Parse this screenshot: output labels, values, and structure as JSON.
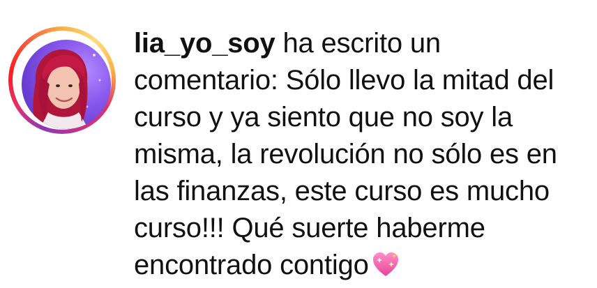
{
  "notification": {
    "username": "lia_yo_soy",
    "action_text": " ha escrito un comentario: ",
    "comment": "Sólo llevo la mitad del curso y ya siento que no soy la misma, la revolución no sólo es en las finanzas, este curso es mucho curso!!! Qué suerte haberme encontrado contigo",
    "emoji_icon": "sparkling-heart-icon",
    "story_ring_colors": [
      "#8a3ab9",
      "#e1306c",
      "#fd1d1d",
      "#f56040",
      "#fcaf45"
    ]
  }
}
